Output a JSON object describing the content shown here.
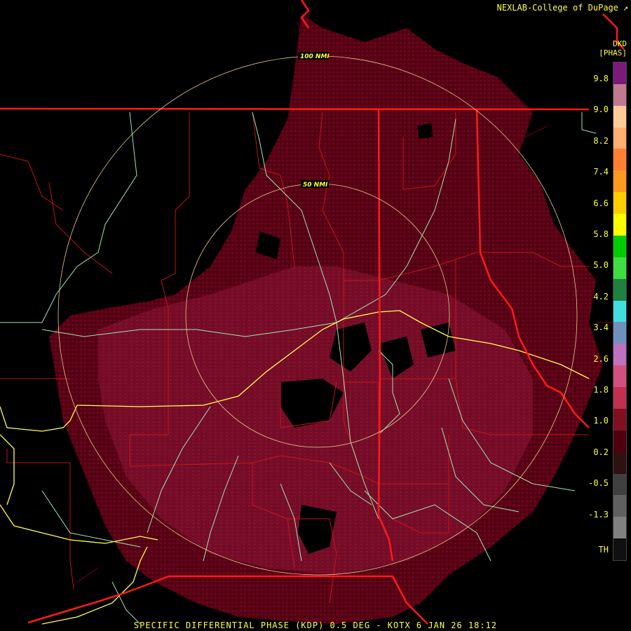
{
  "credit": "NEXLAB-College of DuPage",
  "credit_icon": "corner-arrow-icon",
  "product": {
    "code": "DKD",
    "unit": "[PHAS]"
  },
  "footer": "SPECIFIC DIFFERENTIAL PHASE (KDP) 0.5 DEG - KOTX 6 JAN 26 18:12",
  "rings": [
    {
      "label": "100 NMI"
    },
    {
      "label": "50 NMI"
    }
  ],
  "legend": {
    "labels": [
      "9.8",
      "9.0",
      "8.2",
      "7.4",
      "6.6",
      "5.8",
      "5.0",
      "4.2",
      "3.4",
      "2.6",
      "1.8",
      "1.0",
      "0.2",
      "-0.5",
      "-1.3",
      "TH"
    ],
    "colors": [
      "#7a1a7a",
      "#c07a90",
      "#ffcc99",
      "#ffb070",
      "#ff8030",
      "#ff9a20",
      "#ffcc00",
      "#ffff00",
      "#00cc00",
      "#40dd40",
      "#208040",
      "#40e0e0",
      "#7090c0",
      "#c070c0",
      "#d05080",
      "#c03050",
      "#801020",
      "#500010",
      "#301010",
      "#404040",
      "#606060",
      "#808080",
      "#101010"
    ]
  },
  "colors": {
    "echo": "#5a0014",
    "echo_light": "#7a0e2a",
    "state_border": "#ff1a1a",
    "county_border": "#d01818",
    "highway": "#9ee6b4",
    "interstate": "#ffff50",
    "ring": "#e6c890",
    "text": "#ffff40"
  }
}
